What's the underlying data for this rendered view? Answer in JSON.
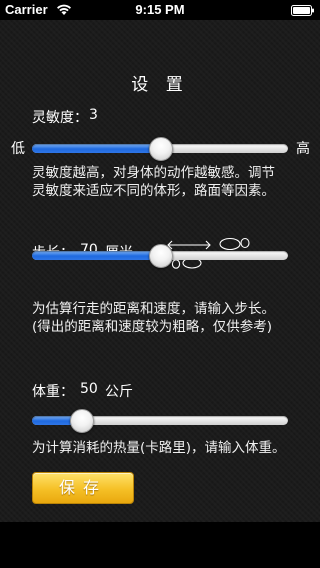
{
  "status_bar": {
    "carrier": "Carrier",
    "time": "9:15 PM"
  },
  "title": "设 置",
  "sensitivity": {
    "label": "灵敏度：",
    "value": "3",
    "min_label": "低",
    "max_label": "高",
    "level_fraction": 0.5,
    "desc_line1": "灵敏度越高，对身体的动作越敏感。调节",
    "desc_line2": "灵敏度来适应不同的体形，路面等因素。"
  },
  "step": {
    "label": "步长：",
    "value": "70",
    "unit": "厘米",
    "level_fraction": 0.5,
    "desc_line1": "为估算行走的距离和速度，请输入步长。",
    "desc_line2": "(得出的距离和速度较为粗略，仅供参考)"
  },
  "weight": {
    "label": "体重：",
    "value": "50",
    "unit": "公斤",
    "level_fraction": 0.19,
    "desc_line1": "为计算消耗的热量(卡路里)，请输入体重。"
  },
  "save_button": {
    "label": "保存"
  },
  "colors": {
    "slider_fill": "#2f76e6",
    "save_button": "#f5c026",
    "background": "#1c1c1c"
  },
  "icons": [
    "wifi-icon",
    "battery-icon",
    "footprints-icon"
  ]
}
